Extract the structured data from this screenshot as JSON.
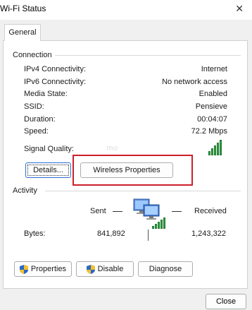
{
  "window": {
    "title": "Wi-Fi Status",
    "close_glyph": "✕"
  },
  "tabs": [
    {
      "label": "General"
    }
  ],
  "connection": {
    "section_label": "Connection",
    "rows": [
      {
        "label": "IPv4 Connectivity:",
        "value": "Internet"
      },
      {
        "label": "IPv6 Connectivity:",
        "value": "No network access"
      },
      {
        "label": "Media State:",
        "value": "Enabled"
      },
      {
        "label": "SSID:",
        "value": "Pensieve"
      },
      {
        "label": "Duration:",
        "value": "00:04:07"
      },
      {
        "label": "Speed:",
        "value": "72.2 Mbps"
      }
    ],
    "signal_quality_label": "Signal Quality:",
    "signal_bars": 5,
    "signal_bars_lit": 5,
    "details_button": "Details...",
    "wireless_properties_button": "Wireless Properties"
  },
  "activity": {
    "section_label": "Activity",
    "sent_label": "Sent",
    "received_label": "Received",
    "bytes_label": "Bytes:",
    "bytes_sent": "841,892",
    "bytes_received": "1,243,322"
  },
  "actions": {
    "properties_button": "Properties",
    "disable_button": "Disable",
    "diagnose_button": "Diagnose"
  },
  "footer": {
    "close_button": "Close"
  },
  "colors": {
    "highlight": "#cc1f2b",
    "signal_green": "#2ea043",
    "accent": "#2a6fd6"
  }
}
